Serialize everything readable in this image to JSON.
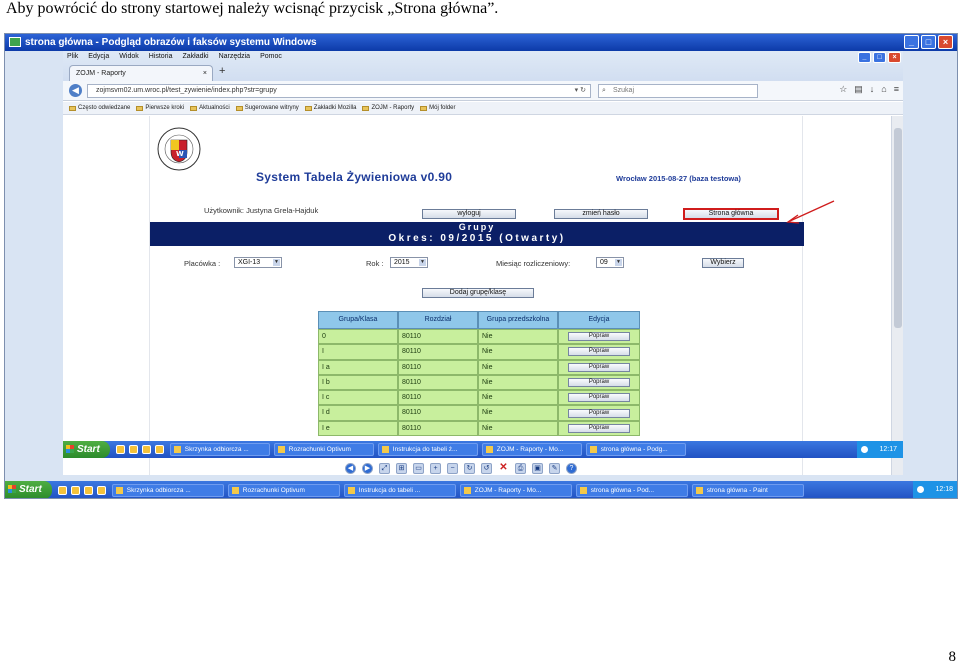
{
  "caption": "Aby powrócić do strony startowej należy wcisnąć przycisk „Strona główna”.",
  "page_number": "8",
  "paint": {
    "title": "strona główna - Podgląd obrazów i faksów systemu Windows"
  },
  "browser": {
    "menu": [
      "Plik",
      "Edycja",
      "Widok",
      "Historia",
      "Zakładki",
      "Narzędzia",
      "Pomoc"
    ],
    "tab_title": "ZOJM - Raporty",
    "tab_close": "×",
    "new_tab": "+",
    "url": "zojmsvm02.um.wroc.pl/test_zywienie/index.php?str=grupy",
    "search_placeholder": "Szukaj",
    "bookmarks": [
      "Często odwiedzane",
      "Pierwsze kroki",
      "Aktualności",
      "Sugerowane witryny",
      "Zakładki Mozilla",
      "ZOJM - Raporty",
      "Mój folder"
    ]
  },
  "app": {
    "title": "System Tabela Żywieniowa v0.90",
    "date_info": "Wrocław 2015-08-27 (baza testowa)",
    "user_label": "Użytkownik: Justyna Grela-Hajduk",
    "logout": "wyloguj",
    "change_password": "zmień hasło",
    "home": "Strona główna",
    "banner_title": "Grupy",
    "banner_period": "Okres: 09/2015 (Otwarty)",
    "filters": {
      "placowka_label": "Placówka :",
      "placowka_value": "XGI-13",
      "rok_label": "Rok :",
      "rok_value": "2015",
      "miesiac_label": "Miesiąc rozliczeniowy:",
      "miesiac_value": "09",
      "choose": "Wybierz"
    },
    "add_group": "Dodaj grupę/klasę",
    "table": {
      "headers": [
        "Grupa/Klasa",
        "Rozdział",
        "Grupa przedszkolna",
        "Edycja"
      ],
      "rows": [
        {
          "grupa": "0",
          "rozdzial": "80110",
          "przedszkolna": "Nie",
          "edit": "Popraw"
        },
        {
          "grupa": "I",
          "rozdzial": "80110",
          "przedszkolna": "Nie",
          "edit": "Popraw"
        },
        {
          "grupa": "I a",
          "rozdzial": "80110",
          "przedszkolna": "Nie",
          "edit": "Popraw"
        },
        {
          "grupa": "I b",
          "rozdzial": "80110",
          "przedszkolna": "Nie",
          "edit": "Popraw"
        },
        {
          "grupa": "I c",
          "rozdzial": "80110",
          "przedszkolna": "Nie",
          "edit": "Popraw"
        },
        {
          "grupa": "I d",
          "rozdzial": "80110",
          "przedszkolna": "Nie",
          "edit": "Popraw"
        },
        {
          "grupa": "I e",
          "rozdzial": "80110",
          "przedszkolna": "Nie",
          "edit": "Popraw"
        }
      ]
    }
  },
  "taskbar_inner": {
    "start": "Start",
    "tasks": [
      "Skrzynka odbiorcza ...",
      "Rozrachunki Optivum",
      "Instrukcja do tabeli ż...",
      "ZOJM - Raporty - Mo...",
      "strona główna - Podg..."
    ],
    "clock": "12:17"
  },
  "taskbar_outer": {
    "start": "Start",
    "tasks": [
      "Skrzynka odbiorcza ...",
      "Rozrachunki Optivum",
      "Instrukcja do tabeli ...",
      "ZOJM - Raporty - Mo...",
      "strona główna - Pod...",
      "strona główna - Paint"
    ],
    "clock": "12:18"
  },
  "colors": {
    "title_blue": "#1f3c99",
    "banner": "#0b1f66",
    "header_cell": "#8fc7ea",
    "row_cell": "#c8ef9d",
    "highlight": "#d01c1c"
  }
}
